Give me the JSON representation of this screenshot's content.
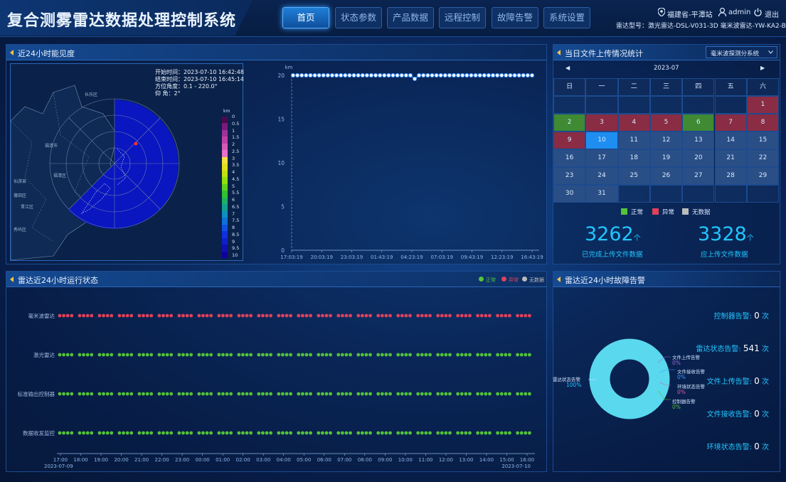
{
  "header": {
    "title": "复合测雾雷达数据处理控制系统",
    "nav": [
      "首页",
      "状态参数",
      "产品数据",
      "远程控制",
      "故障告警",
      "系统设置"
    ],
    "active_nav": "首页",
    "location": "福建省-平潭站",
    "user": "admin",
    "logout": "退出",
    "radar_model": "雷达型号：激光雷达-DSL-V031-3D 毫米波雷达-YW-KA2-B"
  },
  "visibility_panel": {
    "title": "近24小时能见度",
    "map_info": {
      "start": "开始时间：2023-07-10 16:42:48",
      "end": "结束时间：2023-07-10 16:45:14",
      "azimuth": "方位角度：0.1 - 220.0°",
      "elevation": "仰 角：2°"
    },
    "map_labels": [
      "长乐区",
      "福清市",
      "福清区",
      "莆田区",
      "秀屿区",
      "仙游县",
      "晋江区"
    ],
    "legend_unit": "km",
    "legend_values": [
      "0",
      "0.5",
      "1",
      "1.5",
      "2",
      "2.5",
      "3",
      "3.5",
      "4",
      "4.5",
      "5",
      "5.5",
      "6",
      "6.5",
      "7",
      "7.5",
      "8",
      "8.5",
      "9",
      "9.5",
      "10"
    ],
    "legend_colors": [
      "#4a0a4a",
      "#7a1a7a",
      "#a0309a",
      "#c040a8",
      "#d858b8",
      "#ea70c8",
      "#f4e040",
      "#e0e020",
      "#c0e010",
      "#90e010",
      "#60d020",
      "#30c030",
      "#20b060",
      "#10a090",
      "#1090c0",
      "#1070d8",
      "#1050e0",
      "#1030e0",
      "#1020c8",
      "#1010b0",
      "#1000a0"
    ]
  },
  "chart_data": {
    "type": "line",
    "title": "",
    "ylabel": "km",
    "ylim": [
      0,
      20
    ],
    "yticks": [
      "0",
      "5",
      "10",
      "15",
      "20"
    ],
    "x": [
      "17:03:19",
      "20:03:19",
      "23:03:19",
      "01:43:19",
      "04:23:19",
      "07:03:19",
      "09:43:19",
      "12:23:19",
      "16:43:19"
    ],
    "series": [
      {
        "name": "",
        "values": [
          20,
          20,
          20,
          20,
          20,
          20,
          20,
          20,
          20
        ]
      }
    ],
    "point_count": 56,
    "dip_index": 28,
    "dip_value": 19.6
  },
  "upload_panel": {
    "title": "当日文件上传情况统计",
    "dropdown": "毫米波探测分系统",
    "month": "2023-07",
    "prev": "◀",
    "next": "▶",
    "weekdays": [
      "日",
      "一",
      "二",
      "三",
      "四",
      "五",
      "六"
    ],
    "days": [
      {
        "d": "1",
        "s": "abnormal"
      },
      {
        "d": "2",
        "s": "normal"
      },
      {
        "d": "3",
        "s": "abnormal"
      },
      {
        "d": "4",
        "s": "abnormal"
      },
      {
        "d": "5",
        "s": "abnormal"
      },
      {
        "d": "6",
        "s": "normal"
      },
      {
        "d": "7",
        "s": "abnormal"
      },
      {
        "d": "8",
        "s": "abnormal"
      },
      {
        "d": "9",
        "s": "abnormal"
      },
      {
        "d": "10",
        "s": "today"
      },
      {
        "d": "11",
        "s": "none"
      },
      {
        "d": "12",
        "s": "none"
      },
      {
        "d": "13",
        "s": "none"
      },
      {
        "d": "14",
        "s": "none"
      },
      {
        "d": "15",
        "s": "none"
      },
      {
        "d": "16",
        "s": "none"
      },
      {
        "d": "17",
        "s": "none"
      },
      {
        "d": "18",
        "s": "none"
      },
      {
        "d": "19",
        "s": "none"
      },
      {
        "d": "20",
        "s": "none"
      },
      {
        "d": "21",
        "s": "none"
      },
      {
        "d": "22",
        "s": "none"
      },
      {
        "d": "23",
        "s": "none"
      },
      {
        "d": "24",
        "s": "none"
      },
      {
        "d": "25",
        "s": "none"
      },
      {
        "d": "26",
        "s": "none"
      },
      {
        "d": "27",
        "s": "none"
      },
      {
        "d": "28",
        "s": "none"
      },
      {
        "d": "29",
        "s": "none"
      },
      {
        "d": "30",
        "s": "none"
      },
      {
        "d": "31",
        "s": "none"
      }
    ],
    "legend": {
      "normal": "正常",
      "abnormal": "异常",
      "none": "无数据"
    },
    "colors": {
      "normal": "#3f8a33",
      "abnormal": "#8a2c44",
      "today": "#1e8ef0",
      "none": "#2a4f86"
    },
    "completed_value": "3262",
    "completed_unit": "个",
    "completed_label": "已完成上传文件数据",
    "should_value": "3328",
    "should_unit": "个",
    "should_label": "应上传文件数据"
  },
  "status_panel": {
    "title": "雷达近24小时运行状态",
    "legend": {
      "normal": "正常",
      "abnormal": "异常",
      "none": "无数据"
    },
    "colors": {
      "normal": "#54c23a",
      "abnormal": "#e0415a",
      "none": "#bbbbbb"
    },
    "rows": [
      {
        "label": "毫米波雷达",
        "state": "abnormal"
      },
      {
        "label": "激光雷达",
        "state": "normal"
      },
      {
        "label": "标准输出控制器",
        "state": "normal"
      },
      {
        "label": "数据收发监控",
        "state": "normal"
      }
    ],
    "time_ticks": [
      "17:00",
      "18:00",
      "19:00",
      "20:00",
      "21:00",
      "22:00",
      "23:00",
      "00:00",
      "01:00",
      "02:00",
      "03:00",
      "04:00",
      "05:00",
      "06:00",
      "07:00",
      "08:00",
      "09:00",
      "10:00",
      "11:00",
      "12:00",
      "13:00",
      "14:00",
      "15:00",
      "16:00"
    ],
    "date_start": "2023-07-09",
    "date_end": "2023-07-10"
  },
  "fault_panel": {
    "title": "雷达近24小时故障告警",
    "alarms": [
      {
        "label": "控制器告警:",
        "value": "0",
        "unit": "次"
      },
      {
        "label": "雷达状态告警:",
        "value": "541",
        "unit": "次"
      },
      {
        "label": "文件上传告警:",
        "value": "0",
        "unit": "次"
      },
      {
        "label": "文件接收告警:",
        "value": "0",
        "unit": "次"
      },
      {
        "label": "环境状态告警:",
        "value": "0",
        "unit": "次"
      }
    ],
    "pie": [
      {
        "name": "雷达状态告警",
        "pct": "100%",
        "value": 100
      },
      {
        "name": "文件上传告警",
        "pct": "0%",
        "value": 0
      },
      {
        "name": "文件接收告警",
        "pct": "0%",
        "value": 0
      },
      {
        "name": "环境状态告警",
        "pct": "0%",
        "value": 0
      },
      {
        "name": "控制器告警",
        "pct": "0%",
        "value": 0
      }
    ],
    "pie_color": "#5ad8ee"
  }
}
